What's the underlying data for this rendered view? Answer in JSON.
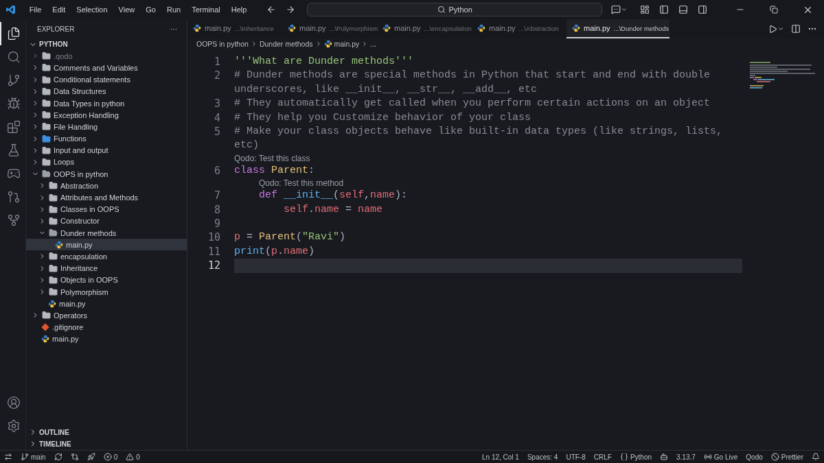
{
  "menu": [
    "File",
    "Edit",
    "Selection",
    "View",
    "Go",
    "Run",
    "Terminal",
    "Help"
  ],
  "search": {
    "label": "Python"
  },
  "activity_bar": [
    {
      "kind": "explorer",
      "selected": true
    },
    {
      "kind": "search",
      "selected": false
    },
    {
      "kind": "source-control",
      "selected": false
    },
    {
      "kind": "debug",
      "selected": false
    },
    {
      "kind": "extensions",
      "selected": false
    },
    {
      "kind": "testing",
      "selected": false
    },
    {
      "kind": "gamepad",
      "selected": false
    },
    {
      "kind": "git-graph",
      "selected": false
    },
    {
      "kind": "git-remote",
      "selected": false
    }
  ],
  "activity_bottom": [
    {
      "kind": "account"
    },
    {
      "kind": "settings"
    }
  ],
  "explorer": {
    "title": "EXPLORER",
    "more": "···",
    "root": {
      "name": "PYTHON",
      "expanded": true
    },
    "tree": [
      {
        "name": ".qodo",
        "kind": "folder",
        "expanded": false,
        "dimmed": true,
        "selected": false
      },
      {
        "name": "Comments and Variables",
        "kind": "folder",
        "expanded": false,
        "selected": false
      },
      {
        "name": "Conditional statements",
        "kind": "folder",
        "expanded": false,
        "selected": false
      },
      {
        "name": "Data Structures",
        "kind": "folder",
        "expanded": false,
        "selected": false
      },
      {
        "name": "Data Types in python",
        "kind": "folder",
        "expanded": false,
        "selected": false
      },
      {
        "name": "Exception Handling",
        "kind": "folder",
        "expanded": false,
        "selected": false
      },
      {
        "name": "File Handling",
        "kind": "folder",
        "expanded": false,
        "selected": false
      },
      {
        "name": "Functions",
        "kind": "function-folder",
        "expanded": false,
        "selected": false
      },
      {
        "name": "Input and output",
        "kind": "folder",
        "expanded": false,
        "selected": false
      },
      {
        "name": "Loops",
        "kind": "folder",
        "expanded": false,
        "selected": false
      },
      {
        "name": "OOPS in python",
        "kind": "folder",
        "expanded": true,
        "selected": false,
        "children": [
          {
            "name": "Abstraction",
            "kind": "folder",
            "expanded": false,
            "selected": false
          },
          {
            "name": "Attributes and Methods",
            "kind": "folder",
            "expanded": false,
            "selected": false
          },
          {
            "name": "Classes in OOPS",
            "kind": "folder",
            "expanded": false,
            "selected": false
          },
          {
            "name": "Constructor",
            "kind": "folder",
            "expanded": false,
            "selected": false
          },
          {
            "name": "Dunder methods",
            "kind": "folder",
            "expanded": true,
            "selected": false,
            "children": [
              {
                "name": "main.py",
                "kind": "python",
                "selected": true
              }
            ]
          },
          {
            "name": "encapsulation",
            "kind": "folder",
            "expanded": false,
            "selected": false
          },
          {
            "name": "Inheritance",
            "kind": "folder",
            "expanded": false,
            "selected": false
          },
          {
            "name": "Objects in OOPS",
            "kind": "folder",
            "expanded": false,
            "selected": false
          },
          {
            "name": "Polymorphism",
            "kind": "folder",
            "expanded": false,
            "selected": false
          },
          {
            "name": "main.py",
            "kind": "python",
            "selected": false
          }
        ]
      },
      {
        "name": "Operators",
        "kind": "folder",
        "expanded": false,
        "selected": false
      },
      {
        "name": ".gitignore",
        "kind": "git",
        "selected": false
      },
      {
        "name": "main.py",
        "kind": "python",
        "selected": false
      }
    ],
    "sections": [
      {
        "name": "OUTLINE",
        "expanded": false
      },
      {
        "name": "TIMELINE",
        "expanded": false
      }
    ]
  },
  "tabs": [
    {
      "name": "main.py",
      "path": "...\\Inheritance",
      "selected": false
    },
    {
      "name": "main.py",
      "path": "...\\Polymorphism",
      "selected": false
    },
    {
      "name": "main.py",
      "path": "...\\encapsulation",
      "selected": false
    },
    {
      "name": "main.py",
      "path": "...\\Abstraction",
      "selected": false
    },
    {
      "name": "main.py",
      "path": "...\\Dunder methods",
      "selected": true
    }
  ],
  "breadcrumb": [
    {
      "kind": "folder",
      "text": "OOPS in python"
    },
    {
      "kind": "folder",
      "text": "Dunder methods"
    },
    {
      "kind": "python",
      "text": "main.py"
    },
    {
      "kind": "more",
      "text": "..."
    }
  ],
  "code": [
    {
      "kind": "line",
      "number": "1",
      "tokens": [
        {
          "kind": "string",
          "text": "'''What are Dunder methods'''"
        }
      ]
    },
    {
      "kind": "line",
      "number": "2",
      "tokens": [
        {
          "kind": "comment",
          "text": "# Dunder methods are special methods in Python that start and end with double underscores, like __init__, __str__, __add__, etc"
        }
      ]
    },
    {
      "kind": "line",
      "number": "3",
      "tokens": [
        {
          "kind": "comment",
          "text": "# They automatically get called when you perform certain actions on an object"
        }
      ]
    },
    {
      "kind": "line",
      "number": "4",
      "tokens": [
        {
          "kind": "comment",
          "text": "# They help you Customize behavior of your class"
        }
      ]
    },
    {
      "kind": "line",
      "number": "5",
      "tokens": [
        {
          "kind": "comment",
          "text": "# Make your class objects behave like built-in data types (like strings, lists, etc)"
        }
      ]
    },
    {
      "kind": "lens",
      "indented": false,
      "text": "Qodo: Test this class"
    },
    {
      "kind": "line",
      "number": "6",
      "tokens": [
        {
          "kind": "keyword",
          "text": "class "
        },
        {
          "kind": "class",
          "text": "Parent"
        },
        {
          "kind": "punct",
          "text": ":"
        }
      ]
    },
    {
      "kind": "lens",
      "indented": true,
      "text": "Qodo: Test this method"
    },
    {
      "kind": "line",
      "number": "7",
      "tokens": [
        {
          "kind": "keyword",
          "text": "    def "
        },
        {
          "kind": "function",
          "text": "__init__"
        },
        {
          "kind": "punct",
          "text": "("
        },
        {
          "kind": "variable",
          "text": "self"
        },
        {
          "kind": "punct",
          "text": ","
        },
        {
          "kind": "variable",
          "text": "name"
        },
        {
          "kind": "punct",
          "text": "):"
        }
      ]
    },
    {
      "kind": "line",
      "number": "8",
      "tokens": [
        {
          "kind": "variable",
          "text": "        self"
        },
        {
          "kind": "punct",
          "text": "."
        },
        {
          "kind": "variable",
          "text": "name"
        },
        {
          "kind": "punct",
          "text": " = "
        },
        {
          "kind": "variable",
          "text": "name"
        }
      ]
    },
    {
      "kind": "line",
      "number": "9"
    },
    {
      "kind": "line",
      "number": "10",
      "tokens": [
        {
          "kind": "variable",
          "text": "p"
        },
        {
          "kind": "punct",
          "text": " = "
        },
        {
          "kind": "class",
          "text": "Parent"
        },
        {
          "kind": "punct",
          "text": "("
        },
        {
          "kind": "string",
          "text": "\"Ravi\""
        },
        {
          "kind": "punct",
          "text": ")"
        }
      ]
    },
    {
      "kind": "line",
      "number": "11",
      "tokens": [
        {
          "kind": "function",
          "text": "print"
        },
        {
          "kind": "punct",
          "text": "("
        },
        {
          "kind": "variable",
          "text": "p"
        },
        {
          "kind": "punct",
          "text": "."
        },
        {
          "kind": "variable",
          "text": "name"
        },
        {
          "kind": "punct",
          "text": ")"
        }
      ]
    },
    {
      "kind": "line",
      "number": "12",
      "current": true
    }
  ],
  "status_left": [
    {
      "kind": "remote"
    },
    {
      "kind": "branch",
      "text": "main"
    },
    {
      "kind": "sync"
    },
    {
      "kind": "compare"
    },
    {
      "kind": "rocket"
    },
    {
      "kind": "errors",
      "text": "0"
    },
    {
      "kind": "warnings",
      "text": "0"
    }
  ],
  "status_right": [
    {
      "kind": "text",
      "text": "Ln 12, Col 1"
    },
    {
      "kind": "text",
      "text": "Spaces: 4"
    },
    {
      "kind": "text",
      "text": "UTF-8"
    },
    {
      "kind": "text",
      "text": "CRLF"
    },
    {
      "kind": "language",
      "text": "Python"
    },
    {
      "kind": "copilot"
    },
    {
      "kind": "text",
      "text": "3.13.7"
    },
    {
      "kind": "live",
      "text": "Go Live"
    },
    {
      "kind": "text",
      "text": "Qodo"
    },
    {
      "kind": "prettier",
      "text": "Prettier"
    },
    {
      "kind": "bell"
    }
  ]
}
